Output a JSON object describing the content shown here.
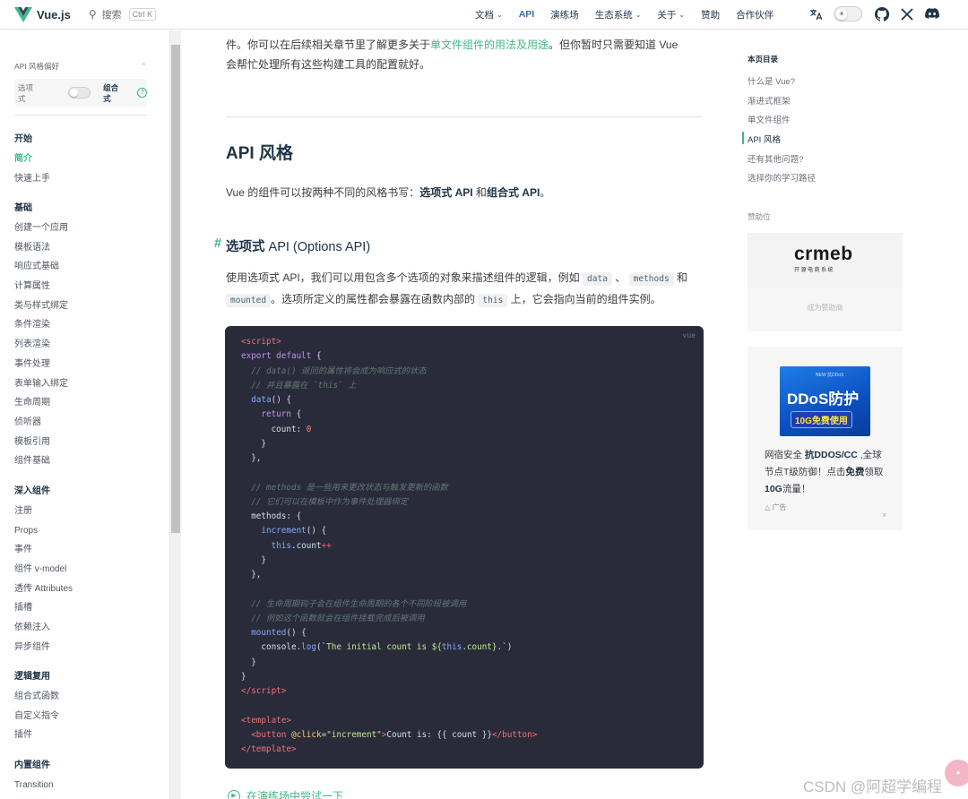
{
  "header": {
    "logo_text": "Vue.js",
    "search_label": "搜索",
    "search_shortcut": "Ctrl K",
    "nav": [
      {
        "label": "文档",
        "caret": true
      },
      {
        "label": "API",
        "caret": false,
        "active": true
      },
      {
        "label": "演练场",
        "caret": false
      },
      {
        "label": "生态系统",
        "caret": true
      },
      {
        "label": "关于",
        "caret": true
      },
      {
        "label": "赞助",
        "caret": false
      },
      {
        "label": "合作伙伴",
        "caret": false
      }
    ],
    "icons": [
      "translate-icon",
      "theme-toggle",
      "github-icon",
      "x-icon",
      "discord-icon"
    ]
  },
  "sidebar": {
    "pref_title": "API 风格偏好",
    "pref_option_label": "选项式",
    "pref_composition_label": "组合式",
    "pref_help": "?",
    "groups": [
      {
        "title": "开始",
        "items": [
          "简介",
          "快速上手"
        ],
        "active": "简介"
      },
      {
        "title": "基础",
        "items": [
          "创建一个应用",
          "模板语法",
          "响应式基础",
          "计算属性",
          "类与样式绑定",
          "条件渲染",
          "列表渲染",
          "事件处理",
          "表单输入绑定",
          "生命周期",
          "侦听器",
          "模板引用",
          "组件基础"
        ]
      },
      {
        "title": "深入组件",
        "items": [
          "注册",
          "Props",
          "事件",
          "组件 v-model",
          "透传 Attributes",
          "插槽",
          "依赖注入",
          "异步组件"
        ]
      },
      {
        "title": "逻辑复用",
        "items": [
          "组合式函数",
          "自定义指令",
          "插件"
        ]
      },
      {
        "title": "内置组件",
        "items": [
          "Transition"
        ]
      }
    ]
  },
  "main": {
    "intro_line1_pre": "件。你可以在后续相关章节里了解更多关于",
    "intro_line1_link": "单文件组件的用法及用途",
    "intro_line1_post": "。但你暂时只需要知道 Vue",
    "intro_line2": "会帮忙处理所有这些构建工具的配置就好。",
    "h2": "API 风格",
    "api_para_pre": "Vue 的组件可以按两种不同的风格书写：",
    "api_para_b1": "选项式 API",
    "api_para_mid": " 和",
    "api_para_b2": "组合式 API",
    "api_para_post": "。",
    "h3_hash": "#",
    "h3_bold": "选项式",
    "h3_rest": " API (Options API)",
    "opt_para1": "使用选项式 API，我们可以用包含多个选项的对象来描述组件的逻辑，例如",
    "code_data": "data",
    "sep1": "、",
    "code_methods": "methods",
    "and": "和",
    "code_mounted": "mounted",
    "opt_para2_mid": "。选项所定义的属性都会暴露在函数内部的",
    "code_this": "this",
    "opt_para2_end": "上，它会指向当前的组件实例。",
    "code_lang": "vue",
    "try_it": "在演练场中尝试一下"
  },
  "aside": {
    "toc_title": "本页目录",
    "toc": [
      "什么是 Vue?",
      "渐进式框架",
      "单文件组件",
      "API 风格",
      "还有其他问题?",
      "选择你的学习路径"
    ],
    "toc_active_index": 3,
    "sponsor_title": "赞助位",
    "sponsor_logo": "crmeb",
    "sponsor_logo_sub": "开源电商系统",
    "become_sponsor": "成为赞助商",
    "ad_img_top": "NEW 抗DDoS",
    "ad_img_big": "DDoS防护",
    "ad_img_pill": "10G免费使用",
    "ad_text_pre": "网宿安全 ",
    "ad_text_b1": "抗DDOS/CC",
    "ad_text_mid": " ,全球节点T级防御！点击",
    "ad_text_b2": "免费",
    "ad_text_mid2": "领取",
    "ad_text_b3": "10G",
    "ad_text_post": "流量！",
    "ad_tag": "广告",
    "ad_close": "×"
  },
  "watermark": "CSDN @阿超学编程"
}
